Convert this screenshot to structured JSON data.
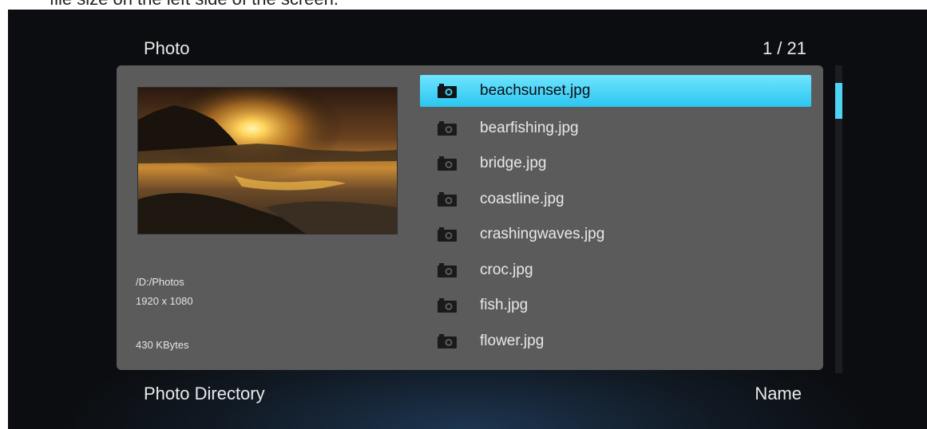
{
  "caption": "file size on the left side of the screen.",
  "header": {
    "title": "Photo",
    "counter": "1 / 21"
  },
  "info": {
    "path": "/D:/Photos",
    "resolution": "1920 x 1080",
    "size": "430 KBytes"
  },
  "files": [
    {
      "name": "beachsunset.jpg",
      "icon": "camera-icon",
      "selected": true
    },
    {
      "name": "bearfishing.jpg",
      "icon": "camera-icon",
      "selected": false
    },
    {
      "name": "bridge.jpg",
      "icon": "camera-icon",
      "selected": false
    },
    {
      "name": "coastline.jpg",
      "icon": "camera-icon",
      "selected": false
    },
    {
      "name": "crashingwaves.jpg",
      "icon": "camera-icon",
      "selected": false
    },
    {
      "name": "croc.jpg",
      "icon": "camera-icon",
      "selected": false
    },
    {
      "name": "fish.jpg",
      "icon": "camera-icon",
      "selected": false
    },
    {
      "name": "flower.jpg",
      "icon": "camera-icon",
      "selected": false
    }
  ],
  "footer": {
    "left": "Photo Directory",
    "right": "Name"
  },
  "colors": {
    "accent": "#3ed0f3",
    "panel": "#5b5b5c"
  }
}
